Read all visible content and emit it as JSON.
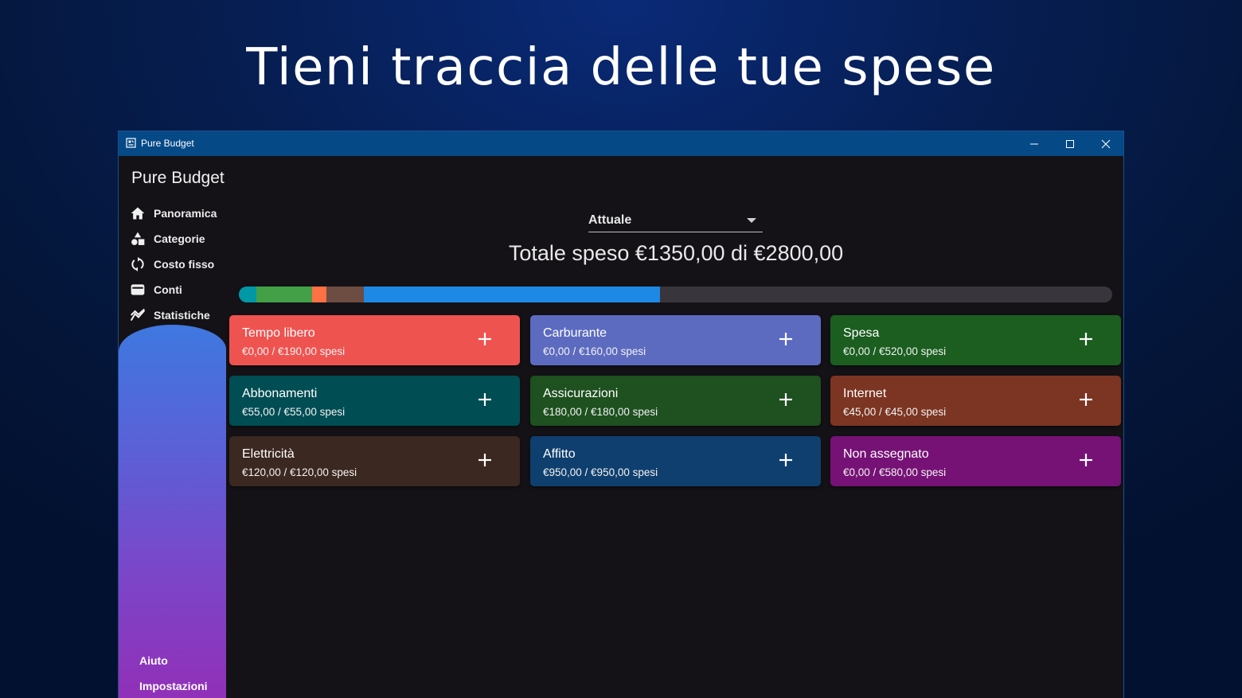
{
  "hero": {
    "title": "Tieni traccia delle tue spese"
  },
  "window": {
    "title": "Pure Budget",
    "controls": {
      "minimize": "minimize-icon",
      "maximize": "maximize-icon",
      "close": "close-icon"
    }
  },
  "sidebar": {
    "app_name": "Pure Budget",
    "items": [
      {
        "label": "Panoramica",
        "icon": "home-icon"
      },
      {
        "label": "Categorie",
        "icon": "shapes-icon"
      },
      {
        "label": "Costo fisso",
        "icon": "recurring-icon"
      },
      {
        "label": "Conti",
        "icon": "wallet-icon"
      },
      {
        "label": "Statistiche",
        "icon": "chart-icon"
      }
    ],
    "footer": [
      {
        "label": "Aiuto"
      },
      {
        "label": "Impostazioni"
      }
    ]
  },
  "period": {
    "selected": "Attuale"
  },
  "summary": {
    "total_text": "Totale speso €1350,00 di €2800,00"
  },
  "progress": {
    "total": 2800,
    "segments": [
      {
        "value": 55,
        "color": "#0097a7"
      },
      {
        "value": 180,
        "color": "#43a047"
      },
      {
        "value": 45,
        "color": "#ff7043"
      },
      {
        "value": 120,
        "color": "#6d4c41"
      },
      {
        "value": 950,
        "color": "#1e88e5"
      }
    ],
    "track_color": "#38353d"
  },
  "categories": [
    {
      "name": "Tempo libero",
      "amount": "€0,00 / €190,00 spesi",
      "color": "#ef5350"
    },
    {
      "name": "Carburante",
      "amount": "€0,00 / €160,00 spesi",
      "color": "#5c6bc0"
    },
    {
      "name": "Spesa",
      "amount": "€0,00 / €520,00 spesi",
      "color": "#1b5e20"
    },
    {
      "name": "Abbonamenti",
      "amount": "€55,00 / €55,00 spesi",
      "color": "#004d53"
    },
    {
      "name": "Assicurazioni",
      "amount": "€180,00 / €180,00 spesi",
      "color": "#1e5020"
    },
    {
      "name": "Internet",
      "amount": "€45,00 / €45,00 spesi",
      "color": "#7b3522"
    },
    {
      "name": "Elettricità",
      "amount": "€120,00 / €120,00 spesi",
      "color": "#3b2820"
    },
    {
      "name": "Affitto",
      "amount": "€950,00 / €950,00 spesi",
      "color": "#0f3f6e"
    },
    {
      "name": "Non assegnato",
      "amount": "€0,00 / €580,00 spesi",
      "color": "#761276"
    }
  ]
}
